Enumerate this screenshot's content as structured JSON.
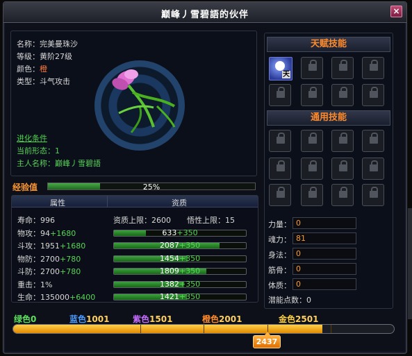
{
  "window": {
    "title": "巅峰丿雪碧語的伙伴",
    "close_label": "×"
  },
  "pet_info": {
    "name_label": "名称：",
    "name_value": "完美曼珠沙",
    "level_label": "等级：",
    "level_value": "黄阶27级",
    "color_label": "颜色：",
    "color_value": "橙",
    "type_label": "类型：",
    "type_value": "斗气攻击",
    "evolve_link": "进化条件",
    "form_label": "当前形态：",
    "form_value": "1",
    "owner_label": "主人名称：",
    "owner_value": "巅峰丿雪碧語"
  },
  "experience": {
    "label": "经验值",
    "percent_text": "25%",
    "percent": 25
  },
  "attributes": {
    "header_attr": "属性",
    "header_qual": "资质",
    "qual_cap_label": "资质上限：",
    "qual_cap_value": "2600",
    "wisdom_cap_label": "悟性上限：",
    "wisdom_cap_value": "15",
    "rows": [
      {
        "name": "寿命：",
        "base": "996",
        "bonus": ""
      },
      {
        "name": "物攻：",
        "base": "94",
        "bonus": "+1680",
        "qual": "633",
        "qual_bonus": "+350",
        "fill": 24
      },
      {
        "name": "斗攻：",
        "base": "1951",
        "bonus": "+1680",
        "qual": "2087",
        "qual_bonus": "+350",
        "fill": 80
      },
      {
        "name": "物防：",
        "base": "2700",
        "bonus": "+780",
        "qual": "1454",
        "qual_bonus": "+350",
        "fill": 56
      },
      {
        "name": "斗防：",
        "base": "2700",
        "bonus": "+780",
        "qual": "1809",
        "qual_bonus": "+350",
        "fill": 70
      },
      {
        "name": "重击：",
        "base": "1%",
        "bonus": "",
        "qual": "1382",
        "qual_bonus": "+350",
        "fill": 53
      },
      {
        "name": "生命：",
        "base": "135000",
        "bonus": "+6400",
        "qual": "1421",
        "qual_bonus": "+350",
        "fill": 55
      }
    ]
  },
  "skills": {
    "talent_title": "天赋技能",
    "general_title": "通用技能",
    "talent_icon_tag": "天"
  },
  "properties": {
    "rows": [
      {
        "label": "力量：",
        "value": "0"
      },
      {
        "label": "魂力：",
        "value": "81"
      },
      {
        "label": "身法：",
        "value": "0"
      },
      {
        "label": "筋骨：",
        "value": "0"
      },
      {
        "label": "体质：",
        "value": "0"
      }
    ],
    "points_label": "潜能点数：",
    "points_value": "0"
  },
  "tiers": {
    "labels": [
      {
        "name": "绿色",
        "value": "0",
        "color": "#5ee05e"
      },
      {
        "name": "蓝色",
        "value": "1001",
        "color": "#4a9cff"
      },
      {
        "name": "紫色",
        "value": "1501",
        "color": "#c46cff"
      },
      {
        "name": "橙色",
        "value": "2001",
        "color": "#ff8a2a"
      },
      {
        "name": "金色",
        "value": "2501",
        "color": "#ffd040"
      }
    ],
    "current": "2437",
    "current_value": 2437,
    "max_value": 3000
  },
  "colors": {
    "accent": "#ff8a2a",
    "green": "#4cd44c",
    "panel": "#0b0f1a"
  }
}
